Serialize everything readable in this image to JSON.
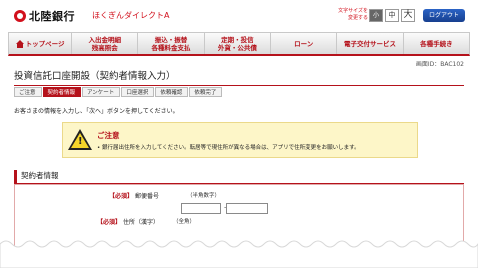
{
  "header": {
    "bank_name": "北陸銀行",
    "service_name": "ほくぎんダイレクトA",
    "fontsize_label": "文字サイズを変更する",
    "fontsize_small": "小",
    "fontsize_mid": "中",
    "fontsize_large": "大",
    "logout": "ログアウト"
  },
  "nav": {
    "items": [
      {
        "label": "トップページ"
      },
      {
        "label1": "入出金明細",
        "label2": "残高照会"
      },
      {
        "label1": "振込・振替",
        "label2": "各種料金支払"
      },
      {
        "label1": "定期・投信",
        "label2": "外貨・公共債"
      },
      {
        "label": "ローン"
      },
      {
        "label": "電子交付サービス"
      },
      {
        "label": "各種手続き"
      }
    ]
  },
  "screen_id": "画面ID：BAC102",
  "page_title": "投資信託口座開設（契約者情報入力）",
  "steps": [
    "ご注意",
    "契約者情報",
    "アンケート",
    "口座選択",
    "依頼確認",
    "依頼完了"
  ],
  "active_step": "契約者情報",
  "instruction": "お客さまの情報を入力し、「次へ」ボタンを押してください。",
  "notice": {
    "title": "ご注意",
    "body": "• 銀行届出住所を入力してください。転居等で現住所が異なる場合は、アプリで住所変更をお願いします。"
  },
  "section": {
    "title": "契約者情報",
    "postal": {
      "required": "【必須】",
      "label": "郵便番号",
      "hint": "（半角数字）"
    },
    "address": {
      "required": "【必須】",
      "label": "住所（漢字）",
      "hint": "（全角）"
    }
  },
  "colors": {
    "brand": "#b5121b",
    "notice_bg": "#fdf6c8"
  }
}
